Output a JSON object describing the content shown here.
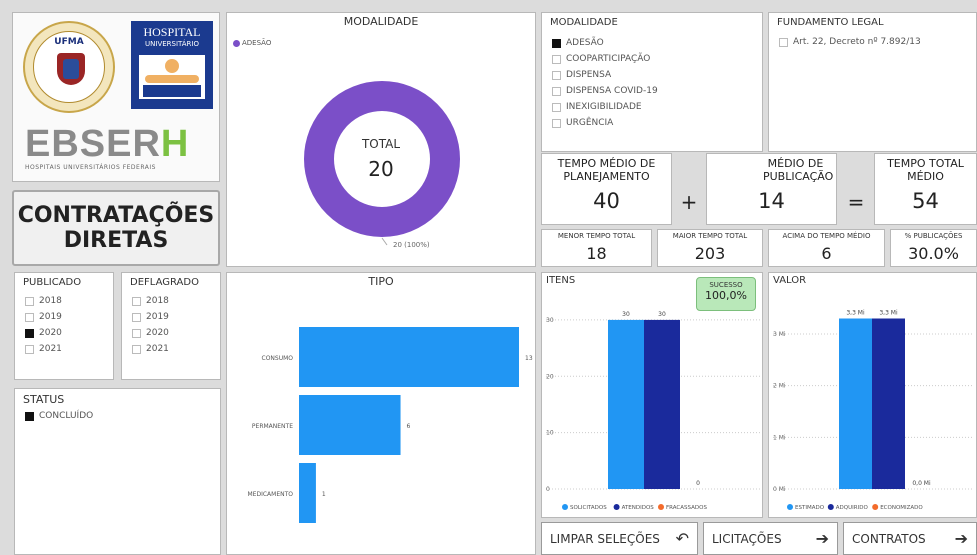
{
  "logos": {
    "ufma_text": "UFMA",
    "ufma_ring": "Universidade Federal do Maranhão",
    "hospital_line1": "HOSPITAL",
    "hospital_line2": "UNIVERSITÁRIO",
    "ebserh": "EBSER",
    "ebserh_h": "H",
    "ebserh_sub": "HOSPITAIS UNIVERSITÁRIOS FEDERAIS"
  },
  "page_title": {
    "line1": "CONTRATAÇÕES",
    "line2": "DIRETAS"
  },
  "modalidade_donut": {
    "title": "MODALIDADE",
    "legend": "ADESÃO",
    "center_label": "TOTAL",
    "center_value": "20",
    "data_label": "20 (100%)",
    "color": "#7b4fc8"
  },
  "modalidade_slicer": {
    "title": "MODALIDADE",
    "items": [
      {
        "label": "ADESÃO",
        "checked": true
      },
      {
        "label": "COOPARTICIPAÇÃO",
        "checked": false
      },
      {
        "label": "DISPENSA",
        "checked": false
      },
      {
        "label": "DISPENSA COVID-19",
        "checked": false
      },
      {
        "label": "INEXIGIBILIDADE",
        "checked": false
      },
      {
        "label": "URGÊNCIA",
        "checked": false
      }
    ]
  },
  "fundamento": {
    "title": "FUNDAMENTO LEGAL",
    "item": "Art. 22, Decreto nº 7.892/13"
  },
  "kpis": {
    "planejamento_label": "TEMPO MÉDIO DE PLANEJAMENTO",
    "planejamento_value": "40",
    "plus": "+",
    "publicacao_label": "MÉDIO DE PUBLICAÇÃO",
    "publicacao_value": "14",
    "equals": "=",
    "total_label": "TEMPO TOTAL MÉDIO",
    "total_value": "54"
  },
  "mini_kpis": [
    {
      "label": "MENOR TEMPO TOTAL",
      "value": "18"
    },
    {
      "label": "MAIOR TEMPO TOTAL",
      "value": "203"
    },
    {
      "label": "ACIMA DO TEMPO MÉDIO",
      "value": "6"
    },
    {
      "label": "% PUBLICAÇÕES",
      "value": "30.0%"
    }
  ],
  "publicado": {
    "title": "PUBLICADO",
    "items": [
      {
        "label": "2018",
        "checked": false
      },
      {
        "label": "2019",
        "checked": false
      },
      {
        "label": "2020",
        "checked": true
      },
      {
        "label": "2021",
        "checked": false
      }
    ]
  },
  "deflagrado": {
    "title": "DEFLAGRADO",
    "items": [
      {
        "label": "2018",
        "checked": false
      },
      {
        "label": "2019",
        "checked": false
      },
      {
        "label": "2020",
        "checked": false
      },
      {
        "label": "2021",
        "checked": false
      }
    ]
  },
  "status": {
    "title": "STATUS",
    "item": "CONCLUÍDO",
    "checked": true
  },
  "chart_data": [
    {
      "type": "bar",
      "orientation": "horizontal",
      "title": "TIPO",
      "categories": [
        "CONSUMO",
        "PERMANENTE",
        "MEDICAMENTO"
      ],
      "values": [
        13,
        6,
        1
      ],
      "color": "#2196f3"
    },
    {
      "type": "bar",
      "title": "ITENS",
      "badge_label": "SUCESSO",
      "badge_value": "100,0%",
      "yticks": [
        "0",
        "10",
        "20",
        "30"
      ],
      "ylim": [
        0,
        33
      ],
      "series": [
        {
          "name": "SOLICITADOS",
          "value": 30,
          "label": "30",
          "color": "#2196f3"
        },
        {
          "name": "ATENDIDOS",
          "value": 30,
          "label": "30",
          "color": "#1a2a9c"
        },
        {
          "name": "FRACASSADOS",
          "value": 0,
          "label": "0",
          "color": "#f36b2b"
        }
      ]
    },
    {
      "type": "bar",
      "title": "VALOR",
      "yticks": [
        "0 Mi",
        "1 Mi",
        "2 Mi",
        "3 Mi"
      ],
      "ylim": [
        0,
        3.6
      ],
      "series": [
        {
          "name": "ESTIMADO",
          "value": 3.3,
          "label": "3,3 Mi",
          "color": "#2196f3"
        },
        {
          "name": "ADQUIRIDO",
          "value": 3.3,
          "label": "3,3 Mi",
          "color": "#1a2a9c"
        },
        {
          "name": "ECONOMIZADO",
          "value": 0,
          "label": "0,0 Mi",
          "color": "#f36b2b"
        }
      ]
    }
  ],
  "buttons": {
    "limpar": "LIMPAR SELEÇÕES",
    "licitacoes": "LICITAÇÕES",
    "contratos": "CONTRATOS"
  }
}
